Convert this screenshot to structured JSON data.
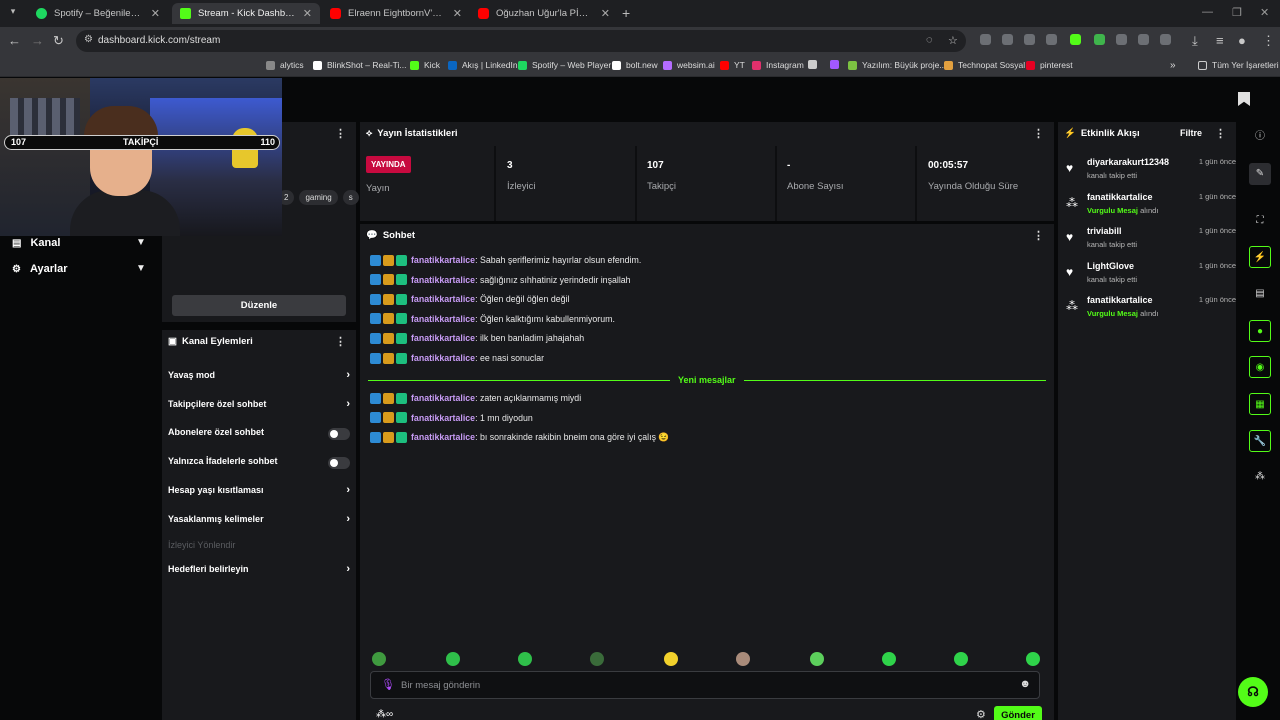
{
  "browser": {
    "tabs": [
      {
        "title": "Spotify – Beğenilen Şarkılar",
        "active": false,
        "fav_color": "#1ed760"
      },
      {
        "title": "Stream - Kick Dashboard",
        "active": true,
        "fav_color": "#53fc18"
      },
      {
        "title": "Elraenn EightbornV'da ki Fail Re",
        "active": false,
        "fav_color": "#ff0000"
      },
      {
        "title": "Oğuzhan Uğur'la PİNÇ: Bölüm",
        "active": false,
        "fav_color": "#ff0000"
      }
    ],
    "url": "dashboard.kick.com/stream",
    "bookmarks": [
      {
        "label": "alytics",
        "color": "#888888"
      },
      {
        "label": "BlinkShot – Real-Ti...",
        "color": "#ffffff"
      },
      {
        "label": "Kick",
        "color": "#53fc18"
      },
      {
        "label": "Akış | LinkedIn",
        "color": "#0a66c2"
      },
      {
        "label": "Spotify – Web Player",
        "color": "#1ed760"
      },
      {
        "label": "bolt.new",
        "color": "#ffffff"
      },
      {
        "label": "websim.ai",
        "color": "#b46cff"
      },
      {
        "label": "YT",
        "color": "#ff0000"
      },
      {
        "label": "Instagram",
        "color": "#e1306c"
      },
      {
        "label": "",
        "color": "#cccccc"
      },
      {
        "label": "",
        "color": "#a259ff"
      },
      {
        "label": "Yazılım: Büyük proje...",
        "color": "#7cc242"
      },
      {
        "label": "Technopat Sosyal",
        "color": "#e2a03f"
      },
      {
        "label": "pinterest",
        "color": "#e60023"
      }
    ],
    "all_bookmarks": "Tüm Yer İşaretleri"
  },
  "overlay": {
    "left_count": "107",
    "label": "TAKİPÇİ",
    "right_count": "110"
  },
  "sidebar": {
    "items": [
      {
        "label": "Kanal",
        "icon": "channel-icon"
      },
      {
        "label": "Ayarlar",
        "icon": "settings-icon"
      }
    ]
  },
  "stream_info": {
    "tags": [
      "2",
      "gaming",
      "s"
    ],
    "edit_button": "Düzenle"
  },
  "stats": {
    "title": "Yayın İstatistikleri",
    "cells": [
      {
        "value": "YAYINDA",
        "label": "Yayın"
      },
      {
        "value": "3",
        "label": "İzleyici"
      },
      {
        "value": "107",
        "label": "Takipçi"
      },
      {
        "value": "-",
        "label": "Abone Sayısı"
      },
      {
        "value": "00:05:57",
        "label": "Yayında Olduğu Süre"
      }
    ]
  },
  "chat": {
    "title": "Sohbet",
    "messages": [
      {
        "user": "fanatikkartalice",
        "text": ": Sabah şeriflerimiz hayırlar olsun efendim."
      },
      {
        "user": "fanatikkartalice",
        "text": ": sağlığınız sıhhatiniz yerindedir inşallah"
      },
      {
        "user": "fanatikkartalice",
        "text": ": Öğlen değil öğlen değil"
      },
      {
        "user": "fanatikkartalice",
        "text": ": Öğlen kalktığımı kabullenmiyorum."
      },
      {
        "user": "fanatikkartalice",
        "text": ": ilk ben banladim jahajahah"
      },
      {
        "user": "fanatikkartalice",
        "text": ": ee nasi sonuclar"
      }
    ],
    "new_messages_label": "Yeni mesajlar",
    "new_messages": [
      {
        "user": "fanatikkartalice",
        "text": ": zaten açıklanmamış miydi"
      },
      {
        "user": "fanatikkartalice",
        "text": ": 1 mn diyodun"
      },
      {
        "user": "fanatikkartalice",
        "text": ": bı sonrakinde rakibin bneim ona göre iyi çalış 😉"
      }
    ],
    "input_placeholder": "Bir mesaj gönderin",
    "send_button": "Gönder",
    "emote_colors": [
      "#3f9a3f",
      "#2fbf4a",
      "#2fbf4a",
      "#3a6b3a",
      "#f2d12c",
      "#a98b7a",
      "#5ccf5c",
      "#2fd34a",
      "#2fd34a",
      "#2fd34a"
    ]
  },
  "channel_actions": {
    "title": "Kanal Eylemleri",
    "items": [
      {
        "label": "Yavaş mod",
        "control": "arrow"
      },
      {
        "label": "Takipçilere özel sohbet",
        "control": "arrow"
      },
      {
        "label": "Abonelere özel sohbet",
        "control": "toggle"
      },
      {
        "label": "Yalnızca İfadelerle sohbet",
        "control": "toggle"
      },
      {
        "label": "Hesap yaşı kısıtlaması",
        "control": "arrow"
      },
      {
        "label": "Yasaklanmış kelimeler",
        "control": "arrow"
      },
      {
        "label": "İzleyici Yönlendir",
        "control": "none"
      },
      {
        "label": "Hedefleri belirleyin",
        "control": "arrow"
      }
    ]
  },
  "event_feed": {
    "title": "Etkinlik Akışı",
    "filter": "Filtre",
    "events": [
      {
        "name": "diyarkarakurt12348",
        "desc": "kanalı takip etti",
        "highlight": "",
        "time": "1 gün önce",
        "icon": "heart-icon"
      },
      {
        "name": "fanatikkartalice",
        "desc": "alındı",
        "highlight": "Vurgulu Mesaj",
        "time": "1 gün önce",
        "icon": "kick-icon"
      },
      {
        "name": "triviabill",
        "desc": "kanalı takip etti",
        "highlight": "",
        "time": "1 gün önce",
        "icon": "heart-icon"
      },
      {
        "name": "LightGlove",
        "desc": "kanalı takip etti",
        "highlight": "",
        "time": "1 gün önce",
        "icon": "heart-icon"
      },
      {
        "name": "fanatikkartalice",
        "desc": "alındı",
        "highlight": "Vurgulu Mesaj",
        "time": "1 gün önce",
        "icon": "kick-icon"
      }
    ]
  }
}
